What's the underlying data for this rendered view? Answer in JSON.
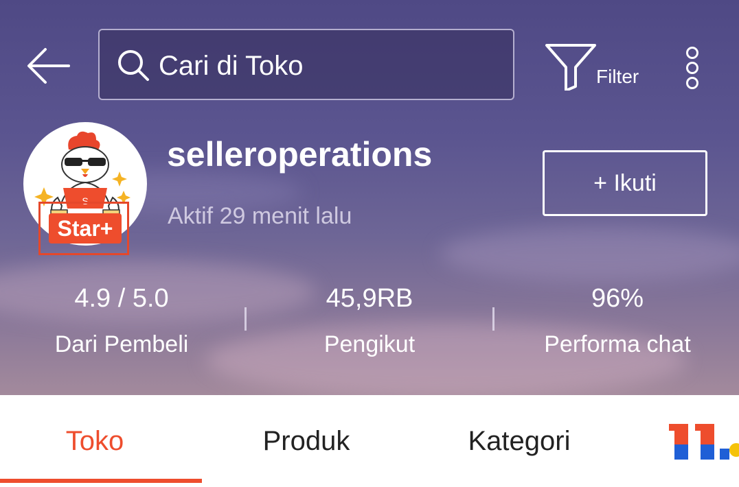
{
  "search": {
    "placeholder": "Cari di Toko"
  },
  "toolbar": {
    "filter_label": "Filter"
  },
  "shop": {
    "name": "selleroperations",
    "status": "Aktif 29 menit lalu",
    "badge": "Star+",
    "avatar_letter": "S",
    "follow_label": "+ Ikuti"
  },
  "stats": [
    {
      "value": "4.9 / 5.0",
      "label": "Dari Pembeli"
    },
    {
      "value": "45,9RB",
      "label": "Pengikut"
    },
    {
      "value": "96%",
      "label": "Performa chat"
    }
  ],
  "tabs": [
    {
      "label": "Toko",
      "active": true
    },
    {
      "label": "Produk",
      "active": false
    },
    {
      "label": "Kategori",
      "active": false
    }
  ],
  "icons": [
    "back-arrow-icon",
    "search-icon",
    "filter-funnel-icon",
    "more-vertical-icon",
    "promo-11-icon"
  ],
  "colors": {
    "accent": "#ee4d2d",
    "header_bg": "#5b5590"
  }
}
